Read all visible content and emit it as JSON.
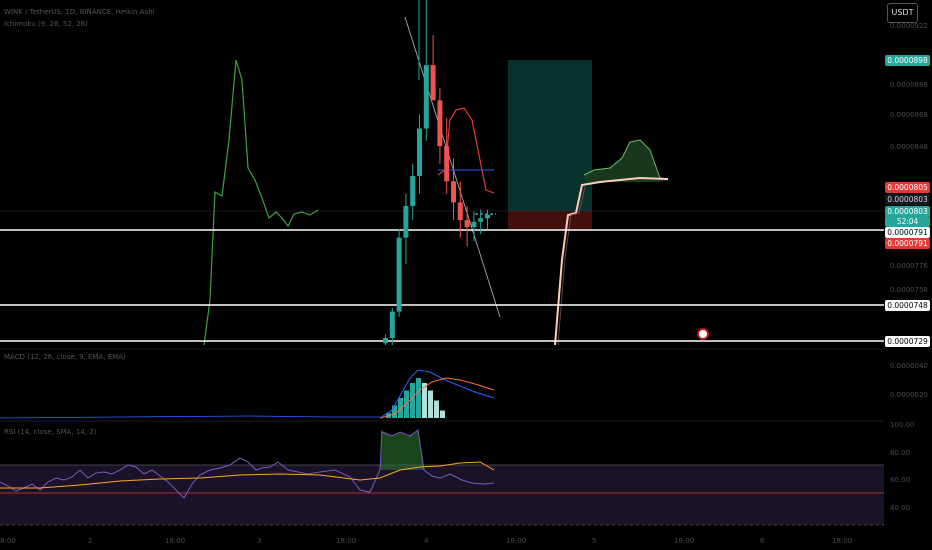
{
  "chart_data": {
    "type": "candlestick",
    "symbol_line": "WINK / TetherUS, 1D, BINANCE, Heikin Ashi",
    "indicator_line": "Ichimoku (9, 26, 52, 26)",
    "macd_label": "MACD (12, 26, close, 9, EMA, EMA)",
    "rsi_label": "RSI (14, close, SMA, 14, 2)",
    "currency": "USDT",
    "price_axis_ticks": [
      "0.0000922",
      "0.0000886",
      "0.0000868",
      "0.0000848",
      "0.0000776",
      "0.0000758"
    ],
    "macd_axis_ticks": [
      "0.0000040",
      "0.0000020"
    ],
    "rsi_axis_ticks": [
      "100.00",
      "80.00",
      "60.00",
      "40.00"
    ],
    "x_ticks": [
      "8:00",
      "2",
      "18:00",
      "3",
      "18:00",
      "4",
      "18:00",
      "5",
      "18:00",
      "6",
      "18:00"
    ],
    "price_labels": [
      {
        "value": "0.0000898",
        "style": "teal"
      },
      {
        "value": "0.0000805",
        "style": "red"
      },
      {
        "value": "0.0000803",
        "style": "dark"
      },
      {
        "value": "0.0000803",
        "style": "teal"
      },
      {
        "value": "52:04",
        "style": "teal"
      },
      {
        "value": "0.0000791",
        "style": "white"
      },
      {
        "value": "0.0000791",
        "style": "red"
      },
      {
        "value": "0.0000748",
        "style": "white"
      },
      {
        "value": "0.0000729",
        "style": "white"
      }
    ],
    "horizontal_levels": [
      7.91e-05,
      7.48e-05,
      7.29e-05
    ],
    "price_ylim": [
      7.29e-05,
      9.25e-05
    ],
    "candles": [
      {
        "o": 7.3e-05,
        "h": 7.35e-05,
        "l": 7.29e-05,
        "c": 7.33e-05
      },
      {
        "o": 7.33e-05,
        "h": 7.5e-05,
        "l": 7.29e-05,
        "c": 7.48e-05
      },
      {
        "o": 7.48e-05,
        "h": 7.95e-05,
        "l": 7.45e-05,
        "c": 7.9e-05
      },
      {
        "o": 7.9e-05,
        "h": 8.15e-05,
        "l": 7.75e-05,
        "c": 8.08e-05
      },
      {
        "o": 8.08e-05,
        "h": 8.32e-05,
        "l": 8e-05,
        "c": 8.25e-05
      },
      {
        "o": 8.25e-05,
        "h": 8.6e-05,
        "l": 8.15e-05,
        "c": 8.52e-05
      },
      {
        "o": 8.52e-05,
        "h": 9.35e-05,
        "l": 8.45e-05,
        "c": 8.88e-05
      },
      {
        "o": 8.88e-05,
        "h": 9.05e-05,
        "l": 8.7e-05,
        "c": 8.68e-05
      },
      {
        "o": 8.68e-05,
        "h": 8.75e-05,
        "l": 8.32e-05,
        "c": 8.42e-05
      },
      {
        "o": 8.42e-05,
        "h": 8.58e-05,
        "l": 8.15e-05,
        "c": 8.22e-05
      },
      {
        "o": 8.22e-05,
        "h": 8.35e-05,
        "l": 8e-05,
        "c": 8.1e-05
      },
      {
        "o": 8.1e-05,
        "h": 8.22e-05,
        "l": 7.9e-05,
        "c": 8e-05
      },
      {
        "o": 8e-05,
        "h": 8.08e-05,
        "l": 7.85e-05,
        "c": 7.96e-05
      },
      {
        "o": 7.96e-05,
        "h": 8.05e-05,
        "l": 7.88e-05,
        "c": 7.99e-05
      },
      {
        "o": 7.99e-05,
        "h": 8.06e-05,
        "l": 7.92e-05,
        "c": 8.01e-05
      },
      {
        "o": 8.01e-05,
        "h": 8.06e-05,
        "l": 7.95e-05,
        "c": 8.03e-05
      }
    ],
    "macd_hist": [
      2e-07,
      5e-07,
      8e-07,
      1.1e-06,
      1.4e-06,
      1.6e-06,
      1.4e-06,
      1.1e-06,
      7e-07,
      3e-07
    ],
    "rsi_ylim": [
      30,
      100
    ],
    "rsi_levels": [
      70,
      50
    ]
  }
}
